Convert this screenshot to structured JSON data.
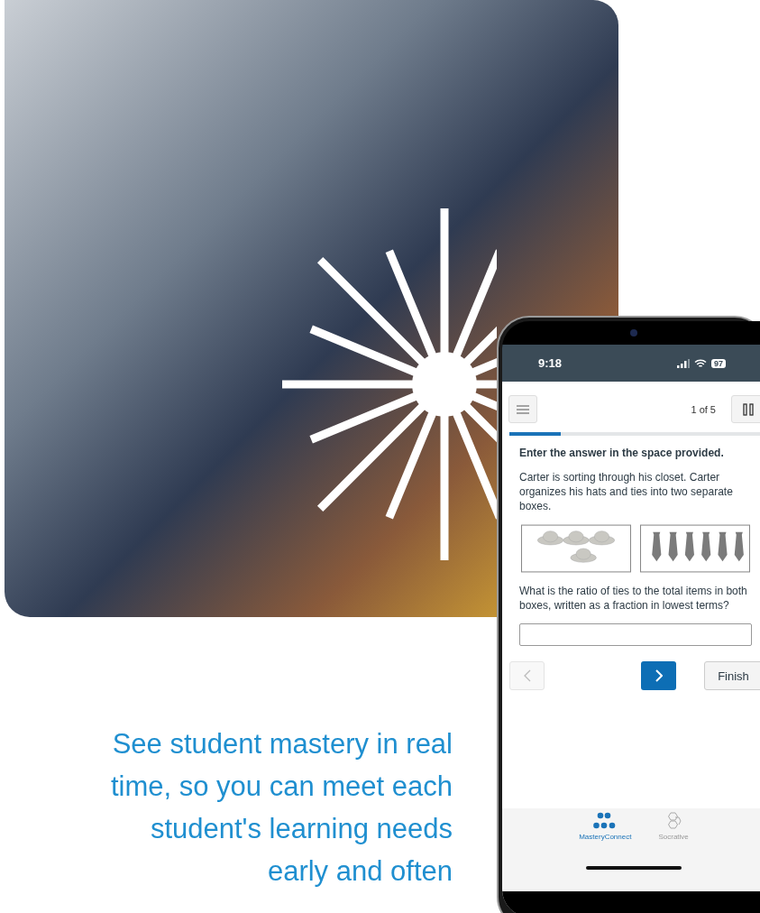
{
  "caption": "See student mastery in real time, so you can meet each student's learning needs early and often",
  "phone": {
    "status": {
      "time": "9:18",
      "battery": "97"
    },
    "toolbar": {
      "counter": "1 of 5"
    },
    "progress": {
      "level": 0.2
    },
    "instruction": "Enter the answer in the space provided.",
    "prompt": "Carter is sorting through his closet. Carter organizes his hats and ties into two separate boxes.",
    "question": "What is the ratio of ties to the total items in both boxes, written as a fraction in lowest terms?",
    "nav": {
      "previous_disabled": true,
      "finish": "Finish"
    },
    "tabs": [
      {
        "kind": "mastery",
        "label": "MasteryConnect",
        "selected": true
      },
      {
        "kind": "socrative",
        "label": "Socrative",
        "selected": false
      }
    ]
  }
}
